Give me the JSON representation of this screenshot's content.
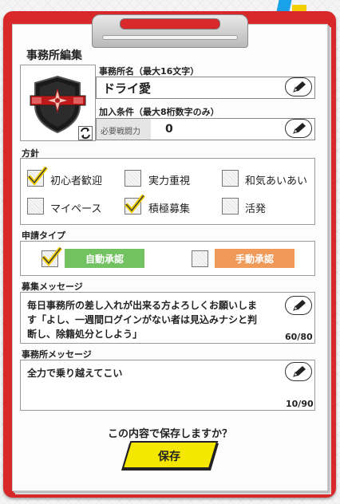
{
  "screen_title": "事務所編集",
  "office_name": {
    "label": "事務所名（最大16文字）",
    "value": "ドライ愛"
  },
  "join_condition": {
    "label": "加入条件（最大8桁数字のみ）",
    "field_label": "必要戦闘力",
    "value": "0"
  },
  "policy": {
    "label": "方針",
    "options": [
      {
        "label": "初心者歓迎",
        "checked": true
      },
      {
        "label": "実力重視",
        "checked": false
      },
      {
        "label": "和気あいあい",
        "checked": false
      },
      {
        "label": "マイペース",
        "checked": false
      },
      {
        "label": "積極募集",
        "checked": true
      },
      {
        "label": "活発",
        "checked": false
      }
    ]
  },
  "application_type": {
    "label": "申請タイプ",
    "auto_label": "自動承認",
    "auto_checked": true,
    "manual_label": "手動承認",
    "manual_checked": false
  },
  "recruit_message": {
    "label": "募集メッセージ",
    "lines": [
      "毎日事務所の差し入れが出来る方よろしくお願いしま",
      "す「よし、一週間ログインがない者は見込みナシと判",
      "断し、除籍処分としよう」"
    ],
    "count": "60/80"
  },
  "office_message": {
    "label": "事務所メッセージ",
    "text": "全力で乗り越えてこい",
    "count": "10/90"
  },
  "confirm_text": "この内容で保存しますか？",
  "save_label": "保存",
  "colors": {
    "board_red": "#d8282a",
    "check_yellow": "#f5d000",
    "auto_green": "#72c262",
    "manual_orange": "#f09a5a",
    "save_yellow": "#f5e800"
  },
  "icons": {
    "edit": "pencil-icon",
    "swap": "swap-icon",
    "emblem": "office-emblem",
    "check": "checkmark-icon"
  }
}
